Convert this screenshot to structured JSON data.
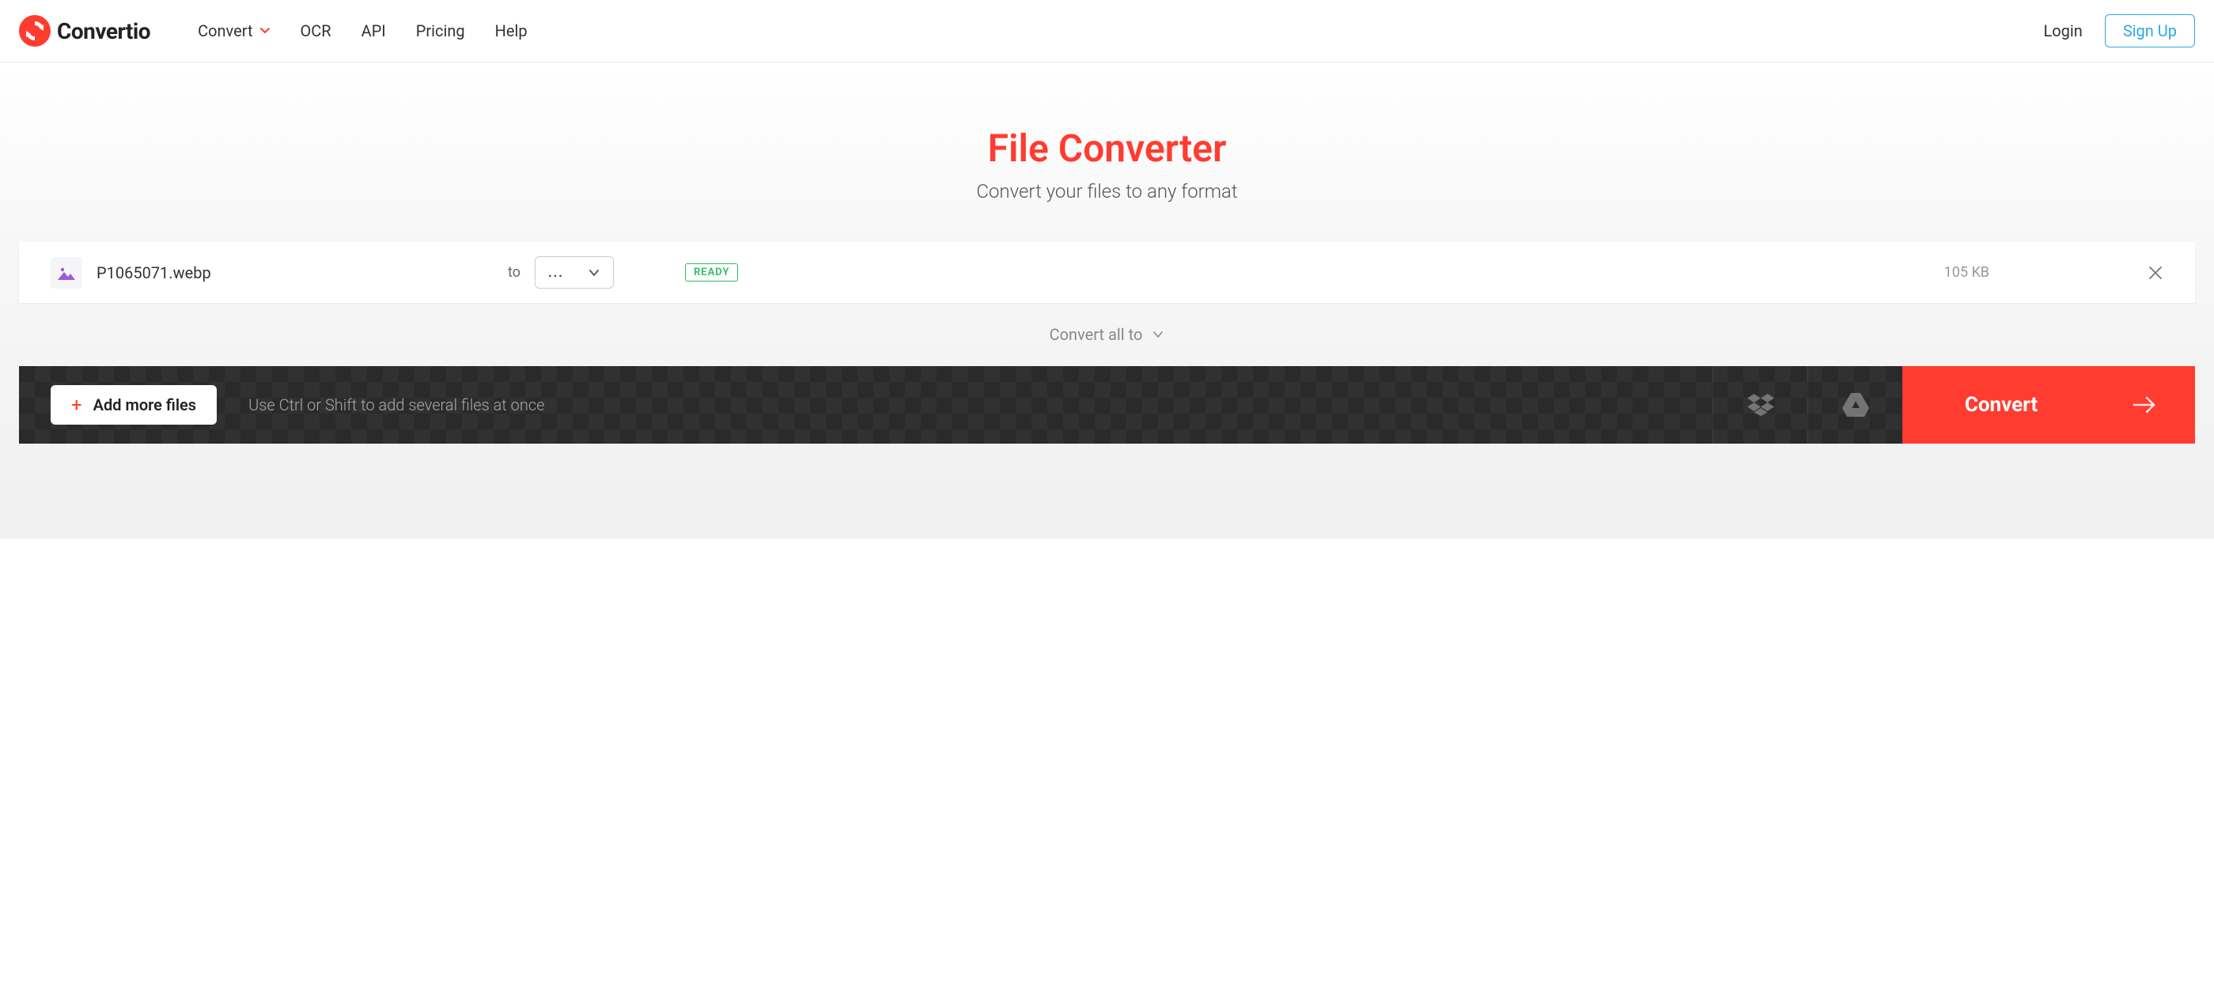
{
  "brand": {
    "name": "Convertio"
  },
  "nav": {
    "items": [
      {
        "label": "Convert",
        "has_dropdown": true
      },
      {
        "label": "OCR"
      },
      {
        "label": "API"
      },
      {
        "label": "Pricing"
      },
      {
        "label": "Help"
      }
    ]
  },
  "auth": {
    "login": "Login",
    "signup": "Sign Up"
  },
  "hero": {
    "title": "File Converter",
    "subtitle": "Convert your files to any format"
  },
  "file": {
    "name": "P1065071.webp",
    "to_label": "to",
    "format_placeholder": "...",
    "status": "READY",
    "size": "105 KB"
  },
  "convert_all": {
    "label": "Convert all to"
  },
  "actions": {
    "add_more": "Add more files",
    "hint": "Use Ctrl or Shift to add several files at once",
    "convert": "Convert"
  },
  "colors": {
    "accent": "#ff3c2f",
    "link": "#2da8e0",
    "success": "#2bbd5e"
  }
}
